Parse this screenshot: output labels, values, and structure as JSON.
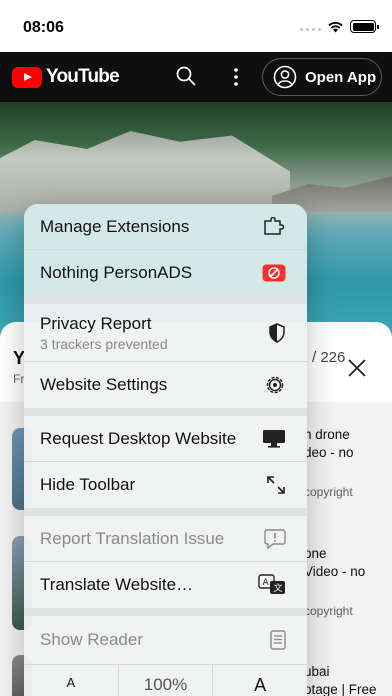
{
  "status": {
    "time": "08:06"
  },
  "header": {
    "logo_text": "YouTube",
    "open_app_label": "Open App"
  },
  "sheet": {
    "title_initial": "Y",
    "subtitle_initial": "Fr",
    "count": "/ 226",
    "videos": [
      {
        "line1": "h drone",
        "line2": "deo - no",
        "meta": "copyright"
      },
      {
        "line1": "one",
        "line2": "Video - no",
        "meta": "copyright"
      },
      {
        "line1": "ubai",
        "line2": "otage | Free",
        "meta": ""
      }
    ]
  },
  "menu": {
    "manage_extensions": "Manage Extensions",
    "nothing_personads": "Nothing PersonADS",
    "privacy_report": "Privacy Report",
    "privacy_sub": "3 trackers prevented",
    "website_settings": "Website Settings",
    "request_desktop": "Request Desktop Website",
    "hide_toolbar": "Hide Toolbar",
    "report_translation": "Report Translation Issue",
    "translate_website": "Translate Website…",
    "show_reader": "Show Reader",
    "font_small": "A",
    "zoom": "100%",
    "font_large": "A"
  },
  "colors": {
    "accent_red": "#ff0000",
    "header_bg": "#0f0f0f"
  }
}
